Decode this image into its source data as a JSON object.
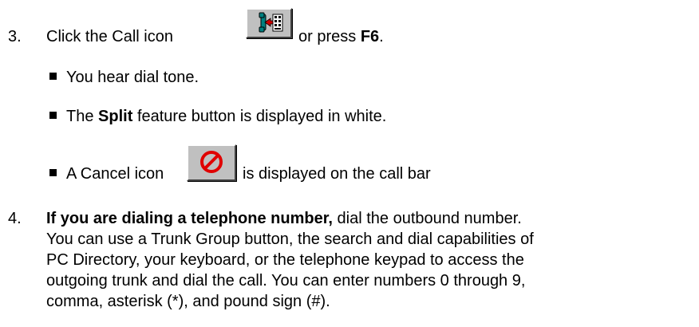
{
  "steps": {
    "step3": {
      "number": "3.",
      "text_before": "Click the Call icon",
      "text_mid": "or press",
      "key": "F6",
      "text_end": "."
    },
    "bullets": {
      "b1": "You hear dial tone.",
      "b2_pre": "The",
      "b2_bold": "Split",
      "b2_post": "feature button is displayed in white.",
      "b3_pre": "A Cancel icon",
      "b3_post": "is displayed on the call bar"
    },
    "step4": {
      "number": "4.",
      "bold_lead": "If you are dialing a telephone number,",
      "line1_rest": "dial the outbound number.",
      "line2": "You can use a Trunk Group button, the search and dial capabilities of",
      "line3": "PC Directory, your keyboard, or the telephone keypad to access the",
      "line4": "outgoing trunk and dial the call.  You can enter numbers 0 through 9,",
      "line5": "comma, asterisk (*), and pound sign (#)."
    }
  },
  "icons": {
    "call": "call-icon",
    "cancel": "cancel-icon"
  },
  "colors": {
    "button_face": "#c0c0c0",
    "cancel_red": "#e00000",
    "call_red": "#cc0000",
    "call_teal": "#008080"
  }
}
